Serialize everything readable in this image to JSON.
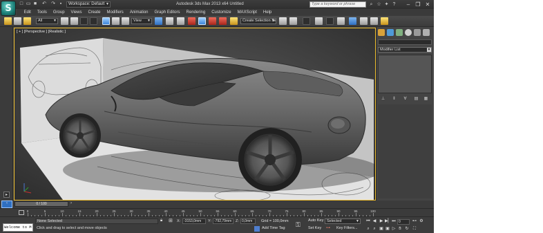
{
  "app": {
    "icon_letter": "S",
    "window_title": "Autodesk 3ds Max 2013 x64     Untitled",
    "workspace": "Workspace: Default"
  },
  "search": {
    "placeholder": "Type a keyword or phrase"
  },
  "menu": [
    "Edit",
    "Tools",
    "Group",
    "Views",
    "Create",
    "Modifiers",
    "Animation",
    "Graph Editors",
    "Rendering",
    "Customize",
    "MAXScript",
    "Help"
  ],
  "toolbar": {
    "selection_filter": "All",
    "reference_coord": "View",
    "named_selection": "Create Selection Se"
  },
  "viewport": {
    "label": "[ + ] [Perspective ] [Realistic ]",
    "background_color": "#3e3e3e",
    "border_color": "#f0c030"
  },
  "command_panel": {
    "modifier_list": "Modifier List"
  },
  "timeline": {
    "slider": "0 / 100",
    "ticks": [
      "0",
      "5",
      "10",
      "15",
      "20",
      "25",
      "30",
      "35",
      "40",
      "45",
      "50",
      "55",
      "60",
      "65",
      "70",
      "75",
      "80",
      "85",
      "90",
      "95",
      "100"
    ]
  },
  "status": {
    "listener_text": "Welcome to M",
    "selection": "None Selected",
    "prompt": "Click and drag to select and move objects",
    "x_label": "X:",
    "x_value": "-3153,0mm",
    "y_label": "Y:",
    "y_value": "-792,79mm",
    "z_label": "Z:",
    "z_value": "0,0mm",
    "grid": "Grid = 100,0mm",
    "add_time_tag": "Add Time Tag",
    "auto_key": "Auto Key",
    "set_key": "Set Key",
    "key_filters": "Key Filters...",
    "key_mode": "Selected",
    "current_frame": "0"
  }
}
